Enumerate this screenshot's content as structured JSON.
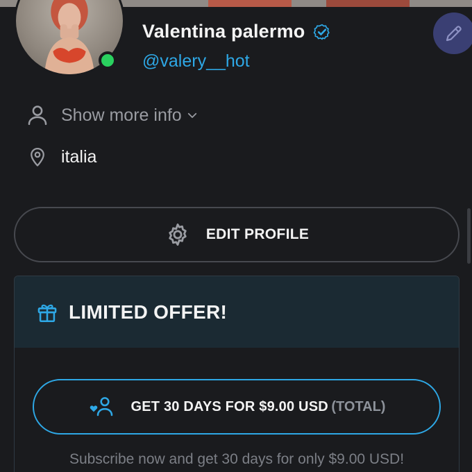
{
  "profile": {
    "name": "Valentina palermo",
    "handle": "@valery__hot",
    "online": true,
    "verified": true
  },
  "info": {
    "show_more_label": "Show more info",
    "location": "italia"
  },
  "actions": {
    "edit_profile_label": "EDIT PROFILE"
  },
  "offer": {
    "title": "LIMITED OFFER!",
    "subscribe_label": "GET 30 DAYS FOR $9.00 USD",
    "subscribe_total": "(TOTAL)",
    "note": "Subscribe now and get 30 days for only $9.00 USD!"
  },
  "icons": {
    "verified": "check-badge-icon",
    "edit_fab": "pencil-icon",
    "user": "user-outline-icon",
    "chevron": "chevron-down-icon",
    "location": "map-pin-icon",
    "settings": "gear-icon",
    "gift": "gift-icon",
    "subscribe": "user-heart-icon"
  },
  "colors": {
    "background": "#1a1b1e",
    "accent": "#2ea8e6",
    "online": "#2ad15f",
    "offer_header": "#1b2a33",
    "muted_text": "#9a9ca2"
  }
}
